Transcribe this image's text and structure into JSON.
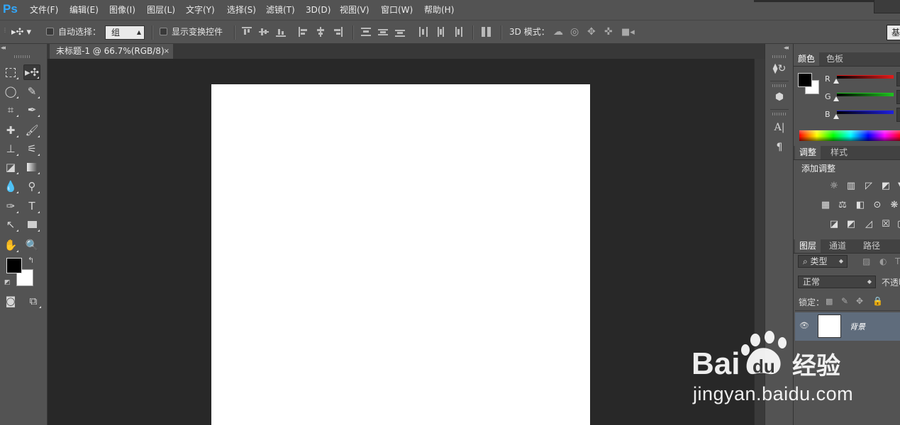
{
  "app": {
    "logo": "Ps"
  },
  "menu": [
    "文件(F)",
    "编辑(E)",
    "图像(I)",
    "图层(L)",
    "文字(Y)",
    "选择(S)",
    "滤镜(T)",
    "3D(D)",
    "视图(V)",
    "窗口(W)",
    "帮助(H)"
  ],
  "options": {
    "auto_select_label": "自动选择：",
    "auto_select_value": "组",
    "show_transform_label": "显示变换控件",
    "mode_3d_label": "3D 模式：",
    "right_button": "基"
  },
  "document": {
    "tab_title": "未标题-1 @ 66.7%(RGB/8)",
    "close_glyph": "×"
  },
  "panels": {
    "color_tabs": [
      "颜色",
      "色板"
    ],
    "rgb_labels": [
      "R",
      "G",
      "B"
    ],
    "slider_colors": [
      "#e01b1b",
      "#1fc21f",
      "#1f1fe0"
    ],
    "adjust_tabs": [
      "调整",
      "样式"
    ],
    "add_adjustment": "添加调整",
    "layer_tabs": [
      "图层",
      "通道",
      "路径"
    ],
    "filter_kind": "类型",
    "blend_mode": "正常",
    "opacity_label": "不透明",
    "lock_label": "锁定：",
    "layer_name": "背景"
  },
  "watermark": {
    "brand_text": "Bai du 经验",
    "url": "jingyan.baidu.com"
  },
  "colors": {
    "ps_blue": "#31a8ff",
    "chrome": "#535353",
    "workspace": "#282828",
    "selected_layer": "#5f6c7c"
  }
}
